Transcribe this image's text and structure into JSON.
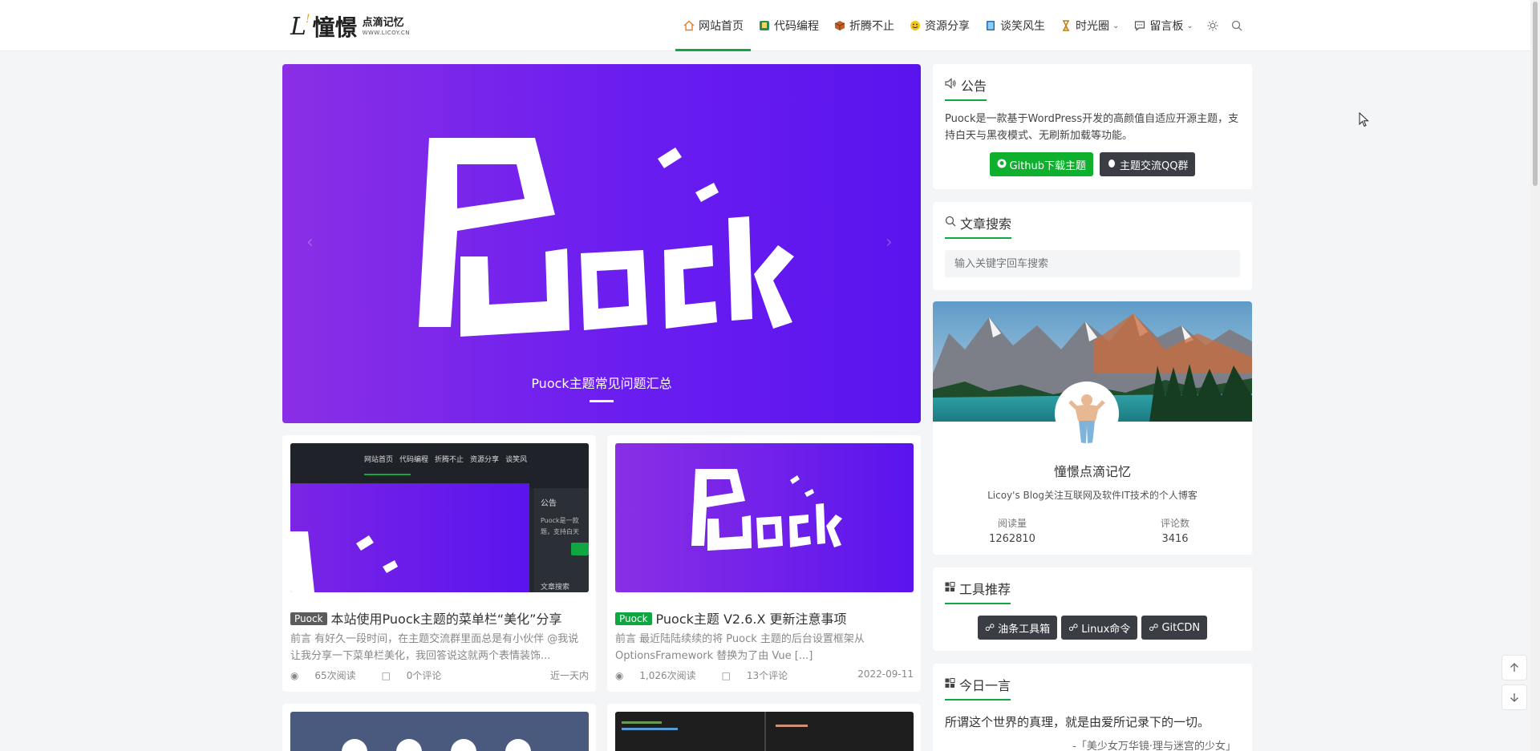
{
  "header": {
    "logo_mark": "L",
    "logo_cn": "憧憬",
    "logo_small": "点滴记忆",
    "logo_url": "WWW.LICOY.CN",
    "nav": [
      {
        "label": "网站首页",
        "icon": "home-icon"
      },
      {
        "label": "代码编程",
        "icon": "code-icon"
      },
      {
        "label": "折腾不止",
        "icon": "box-icon"
      },
      {
        "label": "资源分享",
        "icon": "smile-icon"
      },
      {
        "label": "谈笑风生",
        "icon": "book-icon"
      },
      {
        "label": "时光圈",
        "icon": "hourglass-icon"
      },
      {
        "label": "留言板",
        "icon": "comment-icon"
      }
    ]
  },
  "hero": {
    "logo_text": "Puock",
    "caption": "Puock主题常见问题汇总"
  },
  "posts": [
    {
      "tag": "Puock",
      "tag_color": "#555555",
      "title": "本站使用Puock主题的菜单栏“美化”分享",
      "excerpt": "前言 有好久一段时间，在主题交流群里面总是有小伙伴 @我说让我分享一下菜单栏美化，我回答说这就两个表情装饰...",
      "views": "65次阅读",
      "comments": "0个评论",
      "date": "近一天内",
      "thumb_nav": [
        "网站首页",
        "代码编程",
        "折腾不止",
        "资源分享",
        "谈笑风"
      ],
      "thumb_side_title": "公告",
      "thumb_side_text1": "Puock是一款",
      "thumb_side_text2": "题，支持白天",
      "thumb_side_search": "文章搜索"
    },
    {
      "tag": "Puock",
      "tag_color": "#10a641",
      "title": "Puock主题 V2.6.X 更新注意事项",
      "excerpt": "前言 最近陆陆续续的将 Puock 主题的后台设置框架从 OptionsFramework 替换为了由 Vue [...]",
      "views": "1,026次阅读",
      "comments": "13个评论",
      "date": "2022-09-11",
      "thumb_logo": "Puock"
    }
  ],
  "sidebar": {
    "notice": {
      "title": "公告",
      "text": "Puock是一款基于WordPress开发的高颜值自适应开源主题，支持白天与黑夜模式、无刷新加载等功能。",
      "btn_github": "Github下载主题",
      "btn_qq": "主题交流QQ群"
    },
    "search": {
      "title": "文章搜索",
      "placeholder": "输入关键字回车搜索"
    },
    "profile": {
      "name": "憧憬点滴记忆",
      "desc": "Licoy's Blog关注互联网及软件IT技术的个人博客",
      "stat_views_label": "阅读量",
      "stat_views": "1262810",
      "stat_comments_label": "评论数",
      "stat_comments": "3416"
    },
    "tools": {
      "title": "工具推荐",
      "items": [
        "油条工具箱",
        "Linux命令",
        "GitCDN"
      ]
    },
    "quote": {
      "title": "今日一言",
      "text": "所谓这个世界的真理，就是由爱所记录下的一切。",
      "source": "-「美少女万华镜·理与迷宫的少女」"
    }
  },
  "colors": {
    "accent": "#10a641",
    "dark_button": "#3a3e44",
    "hero_purple": "#6a1df0"
  }
}
